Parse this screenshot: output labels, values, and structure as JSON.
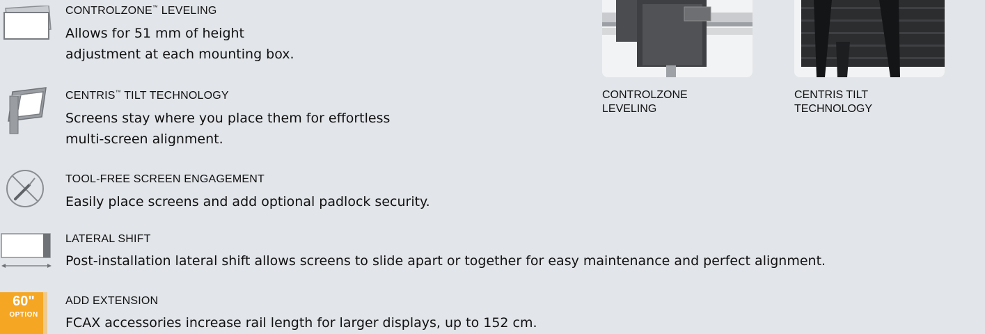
{
  "features": [
    {
      "title_main": "CONTROLZONE",
      "title_tm": "™",
      "title_rest": " LEVELING",
      "desc_lines": [
        "Allows for 51 mm of height",
        "adjustment at each mounting box."
      ],
      "icon": "screen-stack-icon"
    },
    {
      "title_main": "CENTRIS",
      "title_tm": "™",
      "title_rest": " TILT TECHNOLOGY",
      "desc_lines": [
        "Screens stay where you place them for effortless",
        "multi-screen alignment."
      ],
      "icon": "tilted-screen-icon"
    },
    {
      "title_main": "TOOL-FREE SCREEN ENGAGEMENT",
      "desc_lines": [
        "Easily place screens and add optional padlock security."
      ],
      "icon": "no-tool-icon"
    },
    {
      "title_main": "LATERAL SHIFT",
      "desc_lines": [
        "Post-installation lateral shift allows screens to slide apart or together for easy maintenance and perfect alignment."
      ],
      "icon": "lateral-shift-icon"
    },
    {
      "title_main": "ADD EXTENSION",
      "desc_lines": [
        "FCAX accessories increase rail length for larger displays, up to 152 cm."
      ],
      "icon": "extension-option-icon",
      "badge_big": "60\"",
      "badge_small": "OPTION"
    }
  ],
  "photos": [
    {
      "caption_lines": [
        "CONTROLZONE",
        "LEVELING"
      ]
    },
    {
      "caption_lines": [
        "CENTRIS TILT",
        "TECHNOLOGY"
      ]
    }
  ],
  "colors": {
    "background": "#e2e5e9",
    "accent_orange": "#f5a623",
    "icon_gray": "#6f7378"
  }
}
